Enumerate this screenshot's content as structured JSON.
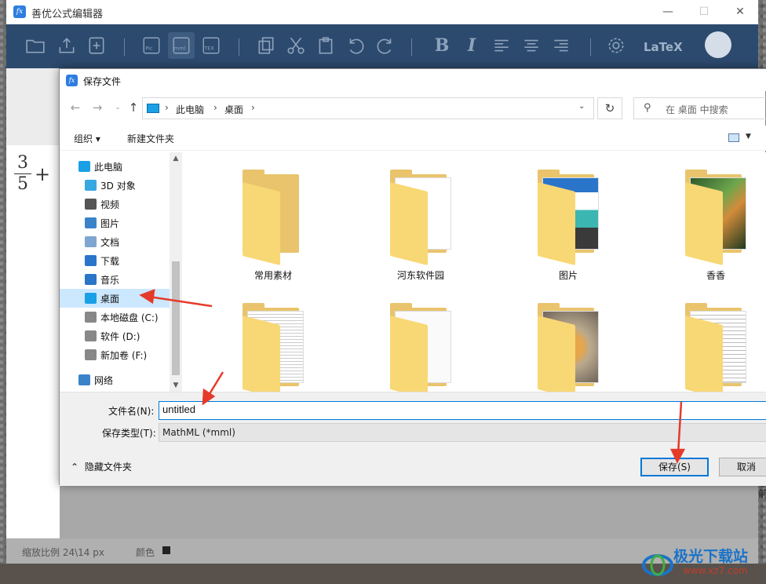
{
  "app": {
    "title": "善优公式编辑器",
    "logo": "fx",
    "latex_label": "LaTeX",
    "status_zoom": "缩放比例 24\\14 px",
    "status_color": "颜色"
  },
  "dialog": {
    "title": "保存文件",
    "breadcrumb": [
      "此电脑",
      "桌面"
    ],
    "search_placeholder": "在 桌面 中搜索",
    "cmd_organize": "组织 ▾",
    "cmd_new_folder": "新建文件夹",
    "sidebar": [
      {
        "label": "此电脑",
        "icon": "computer-icon"
      },
      {
        "label": "3D 对象",
        "icon": "cube-3d-icon"
      },
      {
        "label": "视频",
        "icon": "video-icon"
      },
      {
        "label": "图片",
        "icon": "picture-icon"
      },
      {
        "label": "文档",
        "icon": "document-icon"
      },
      {
        "label": "下载",
        "icon": "download-icon"
      },
      {
        "label": "音乐",
        "icon": "music-icon"
      },
      {
        "label": "桌面",
        "icon": "desktop-icon",
        "selected": true
      },
      {
        "label": "本地磁盘 (C:)",
        "icon": "drive-icon"
      },
      {
        "label": "软件 (D:)",
        "icon": "drive-icon"
      },
      {
        "label": "新加卷 (F:)",
        "icon": "drive-icon"
      },
      {
        "label": "网络",
        "icon": "network-icon"
      }
    ],
    "folders": [
      {
        "name": "常用素材"
      },
      {
        "name": "河东软件园"
      },
      {
        "name": "图片"
      },
      {
        "name": "香香"
      },
      {
        "name": ""
      },
      {
        "name": ""
      },
      {
        "name": ""
      },
      {
        "name": ""
      }
    ],
    "filename_label": "文件名(N):",
    "filename_value": "untitled",
    "filetype_label": "保存类型(T):",
    "filetype_value": "MathML (*mml)",
    "hide_folders": "隐藏文件夹",
    "save_button": "保存(S)",
    "cancel_button": "取消"
  },
  "watermark": {
    "text": "极光下载站",
    "url": "www.xz7.com"
  },
  "colors": {
    "toolbar": "#2c4a6e",
    "accent": "#0078d7",
    "selection": "#cce8ff",
    "folder": "#f8d775",
    "arrow": "#e53a2a"
  }
}
